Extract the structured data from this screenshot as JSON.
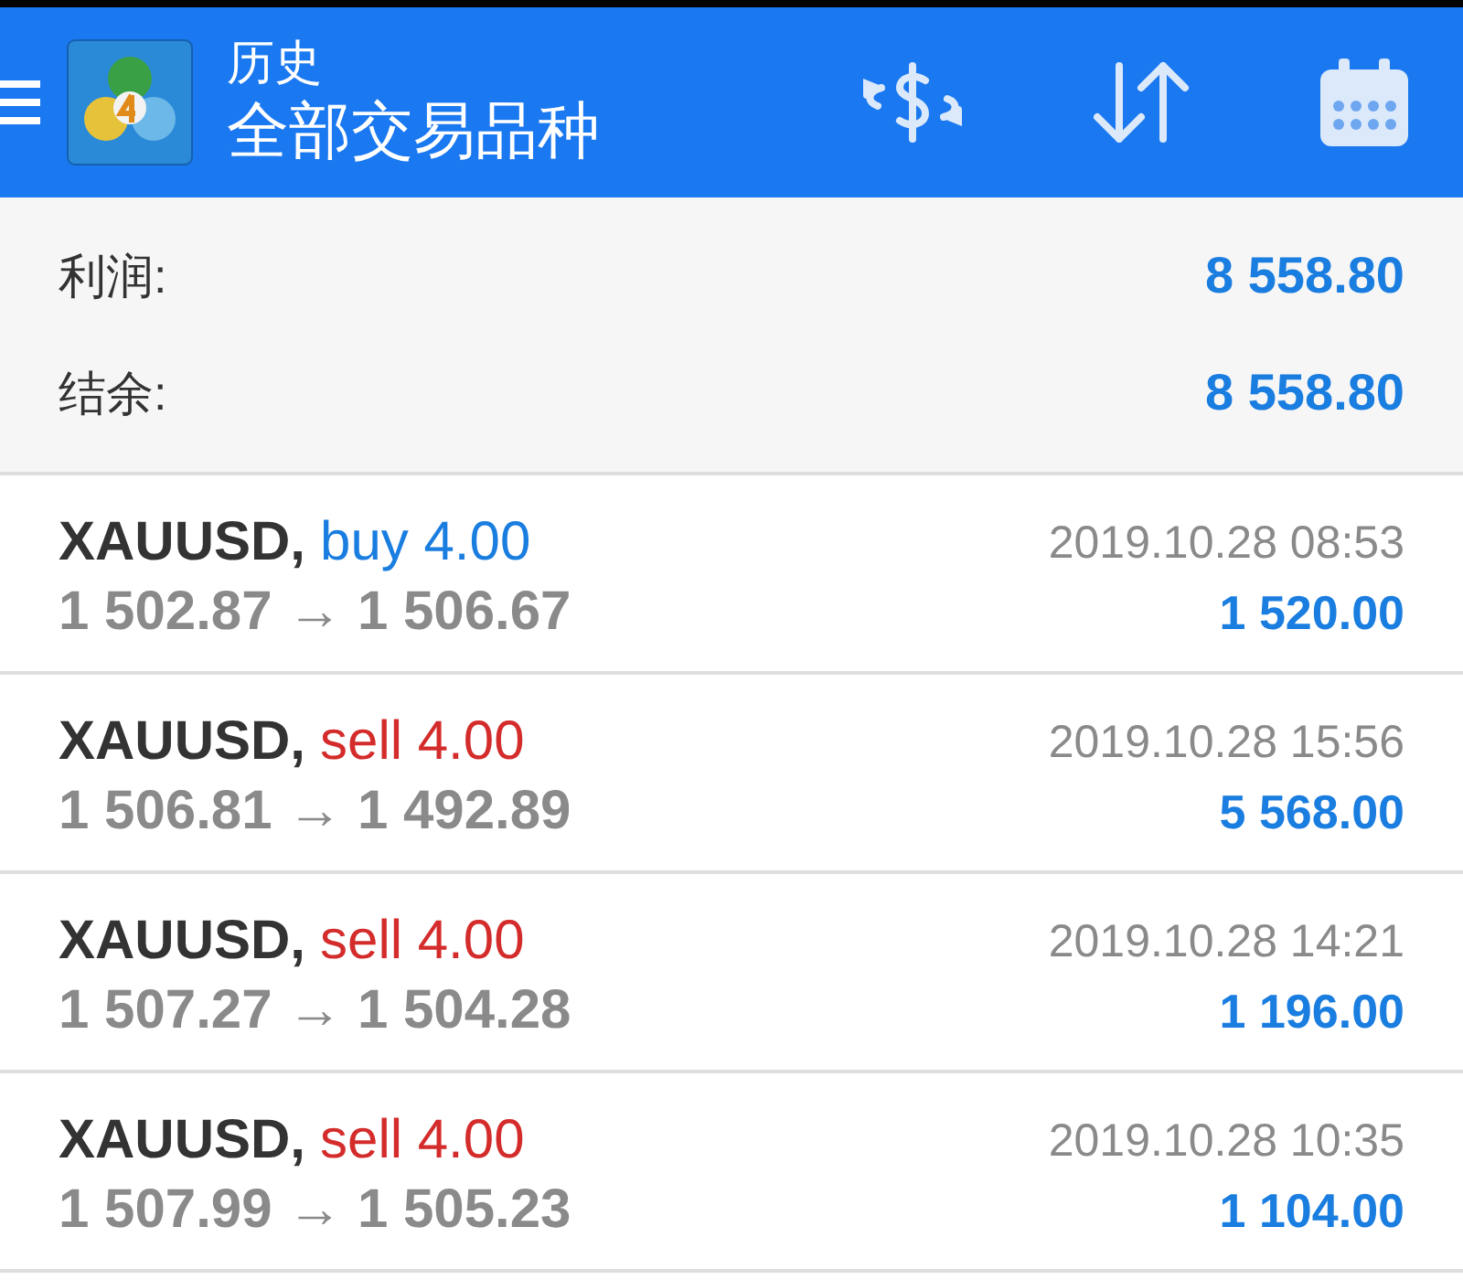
{
  "header": {
    "title": "历史",
    "subtitle": "全部交易品种"
  },
  "summary": [
    {
      "label": "利润:",
      "value": "8 558.80"
    },
    {
      "label": "结余:",
      "value": "8 558.80"
    }
  ],
  "trades": [
    {
      "symbol": "XAUUSD,",
      "side": "buy",
      "volume": "4.00",
      "prices": "1 502.87 → 1 506.67",
      "time": "2019.10.28 08:53",
      "profit": "1 520.00"
    },
    {
      "symbol": "XAUUSD,",
      "side": "sell",
      "volume": "4.00",
      "prices": "1 506.81 → 1 492.89",
      "time": "2019.10.28 15:56",
      "profit": "5 568.00"
    },
    {
      "symbol": "XAUUSD,",
      "side": "sell",
      "volume": "4.00",
      "prices": "1 507.27 → 1 504.28",
      "time": "2019.10.28 14:21",
      "profit": "1 196.00"
    },
    {
      "symbol": "XAUUSD,",
      "side": "sell",
      "volume": "4.00",
      "prices": "1 507.99 → 1 505.23",
      "time": "2019.10.28 10:35",
      "profit": "1 104.00"
    }
  ]
}
